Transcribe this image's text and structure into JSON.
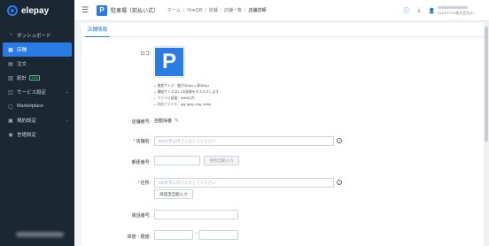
{
  "app": {
    "logo_text": "elepay"
  },
  "sidebar": {
    "items": [
      {
        "label": "ダッシュボード",
        "icon": "dashboard-icon"
      },
      {
        "label": "店舗",
        "icon": "store-icon",
        "active": true
      },
      {
        "label": "注文",
        "icon": "order-icon"
      },
      {
        "label": "統計",
        "icon": "stats-icon",
        "badge": "Beta"
      },
      {
        "label": "サービス設定",
        "icon": "service-settings-icon",
        "has_chevron": true
      },
      {
        "label": "Marketplace",
        "icon": "marketplace-icon"
      },
      {
        "label": "規約設定",
        "icon": "terms-icon",
        "has_chevron": true
      },
      {
        "label": "言語設定",
        "icon": "language-icon"
      }
    ]
  },
  "header": {
    "app_icon_letter": "P",
    "app_title": "駐車場（前払い式）",
    "breadcrumb": [
      "ホーム",
      "OneQR",
      "店舗",
      "店舗一覧",
      "店舗詳細"
    ],
    "user_company": "ELESTYLE株式会社(E..."
  },
  "tabs": [
    {
      "label": "店舗情報",
      "active": true
    }
  ],
  "form": {
    "logo_label": "ロゴ:",
    "logo_letter": "P",
    "logo_hints": [
      "推奨サイズ：幅が300px x 高300px",
      "横縦サイズは1:1の画像をオススメします",
      "ファイル容量：5MB以内",
      "対応ファイル：jpg, jpeg, png, webp"
    ],
    "store_no_label": "店舗番号:",
    "store_no_value": "自動採番",
    "store_name_label": "店舗名:",
    "store_name_placeholder": "300文字以内で入力してください",
    "postal_label": "郵便番号:",
    "postal_button": "住所自動入力",
    "address_label": "住所:",
    "address_placeholder": "300文字以内で入力してください",
    "address_button": "緯度度自動入力",
    "phone_label": "電話番号:",
    "latlng_label": "緯度・経度:",
    "latlng_separator": "-"
  },
  "colors": {
    "accent": "#2b7be4",
    "sidebar_bg": "#1c2734",
    "required": "#e23b3b"
  }
}
